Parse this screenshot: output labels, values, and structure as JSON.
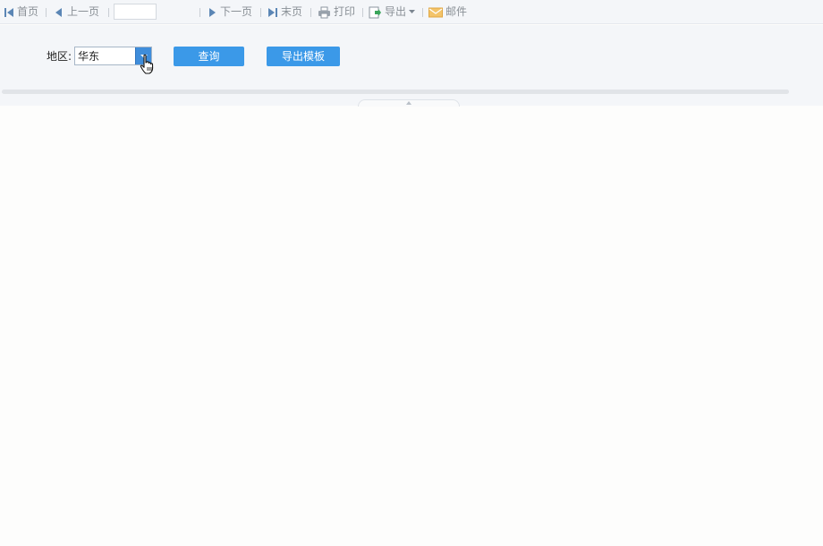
{
  "toolbar": {
    "first": "首页",
    "prev": "上一页",
    "page_value": "",
    "next": "下一页",
    "last": "末页",
    "print": "打印",
    "export": "导出",
    "mail": "邮件"
  },
  "params": {
    "region_label": "地区:",
    "region_value": "华东",
    "query_button": "查询",
    "export_template_button": "导出模板"
  },
  "colors": {
    "accent": "#3b99e8",
    "toolbar_bg": "#f4f6f9"
  }
}
